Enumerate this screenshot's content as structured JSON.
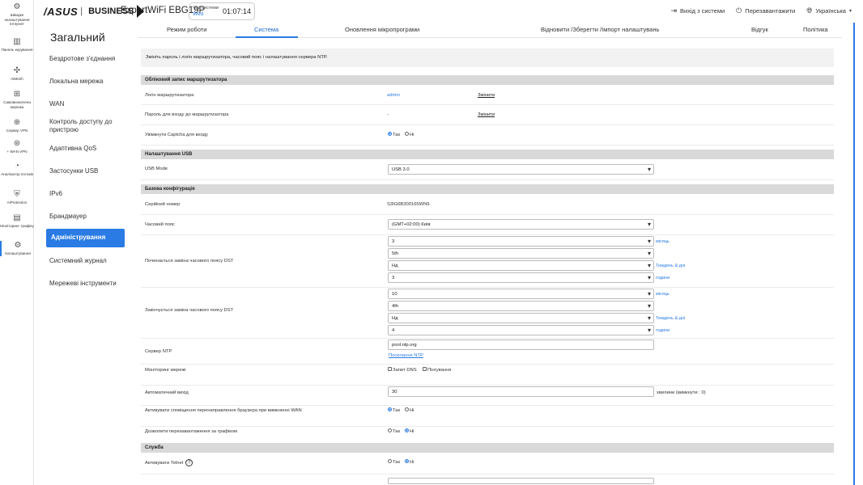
{
  "header": {
    "brand_left": "/ASUS",
    "brand_right": "BUSINESS",
    "model": "ExpertWiFi EBG19P",
    "systime_label": "Час системи",
    "systime_day": "Wed",
    "systime_clock": "01:07:14",
    "logout": "Вихід з системи",
    "reboot": "Перезавантажити",
    "language": "Українська"
  },
  "rail": [
    {
      "icon": "quick-setup-icon",
      "glyph": "⚙",
      "label": "Швидке налаштування Інтернет"
    },
    {
      "icon": "dashboard-icon",
      "glyph": "▥",
      "label": "Панель керування"
    },
    {
      "icon": "aimesh-icon",
      "glyph": "✣",
      "label": "AiMesh"
    },
    {
      "icon": "self-defined-network-icon",
      "glyph": "⊞",
      "label": "Самовизначена мережа"
    },
    {
      "icon": "vpn-server-icon",
      "glyph": "⊕",
      "label": "Сервер VPN"
    },
    {
      "icon": "wan-vpn-icon",
      "glyph": "⊛",
      "label": "+ WAN VPN"
    },
    {
      "icon": "traffic-analyzer-icon",
      "glyph": "◔",
      "label": "Аналізатор потоків"
    },
    {
      "icon": "aiprotection-icon",
      "glyph": "⛨",
      "label": "AiProtection"
    },
    {
      "icon": "traffic-monitor-icon",
      "glyph": "▤",
      "label": "Моніторинг трафіку"
    },
    {
      "icon": "settings-icon",
      "glyph": "⚙",
      "label": "Налаштування"
    }
  ],
  "menu": {
    "title": "Загальний",
    "items": [
      "Бездротове з'єднання",
      "Локальна мережа",
      "WAN",
      "Контроль доступу до пристрою",
      "Адаптивна QoS",
      "Застосунки USB",
      "IPv6",
      "Брандмауер",
      "Адміністрування",
      "Системний журнал",
      "Мережеві інструменти"
    ]
  },
  "tabs": [
    "Режим роботи",
    "Система",
    "Оновлення мікропрограми",
    "Відновити /Зберегти /Імпорт налаштувань",
    "Відгук",
    "Політика"
  ],
  "content": {
    "description": "Змініть пароль і логін маршрутизатора, часовий пояс і налаштування сервера NTP.",
    "sections": {
      "account": "Обліковий запис маршрутизатора",
      "usb": "Налаштування USB",
      "basic": "Базова конфігурація",
      "service": "Служба"
    },
    "rows": {
      "login_label": "Логін маршрутизатора",
      "login_value": "admin",
      "change": "Змінити",
      "password_label": "Пароль для входу до маршрутизатора",
      "password_value": "-",
      "captcha_label": "Увімкнути Captcha для входу",
      "yes": "Так",
      "no": "Ні",
      "usb_mode_label": "USB Mode",
      "usb_mode_value": "USB 3.0",
      "serial_label": "Серійний номер",
      "serial_value": "S3IG6B300165WN9",
      "timezone_label": "Часовий пояс",
      "timezone_value": "(GMT+02:00) Київ",
      "dst_start_label": "Починається заміна часового поясу DST",
      "dst_start": [
        "3",
        "5th",
        "Нд",
        "3"
      ],
      "dst_end_label": "Закінчується заміна часового поясу DST",
      "dst_end": [
        "10",
        "4th",
        "Нд",
        "4"
      ],
      "month": "місяць",
      "week_day": "Тиждень & дні",
      "hours": "години",
      "ntp_label": "Сервер NTP",
      "ntp_value": "pool.ntp.org",
      "ntp_link": "Посилання NTP",
      "netmon_label": "Моніторинг мережі",
      "dns_query": "Запит DNS",
      "ping": "Пінгування",
      "autologout_label": "Автоматичний вихід",
      "autologout_value": "30",
      "autologout_unit": "хвилини (вимкнути : 0)",
      "redirect_label": "Активувати сповіщення перенаправлення браузера при вимкненні WAN",
      "reboot_sched_label": "Дозволити перезавантаження за графіком",
      "telnet_label": "Активувати Telnet"
    }
  }
}
